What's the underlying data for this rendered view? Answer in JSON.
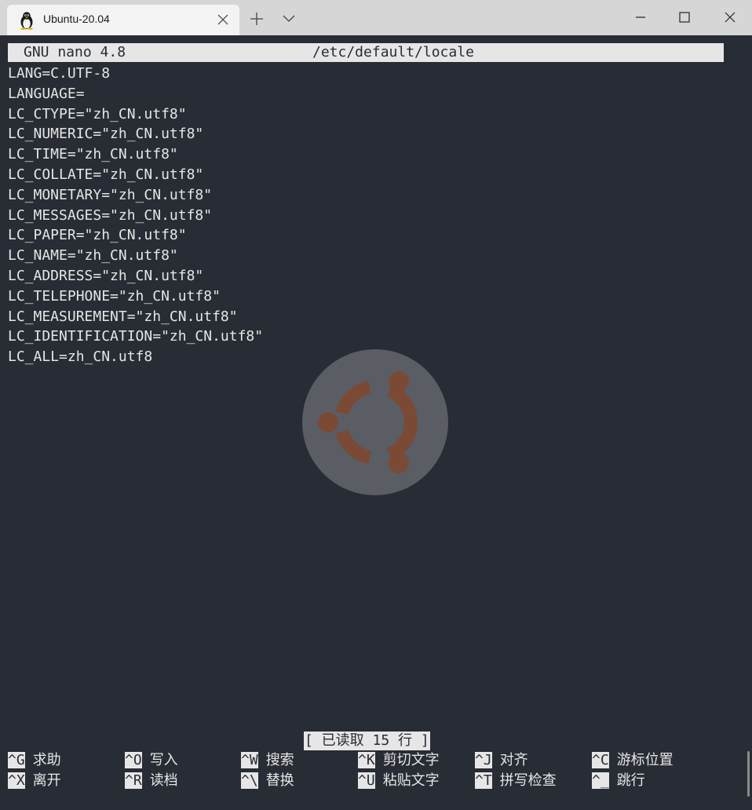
{
  "window": {
    "tab_title": "Ubuntu-20.04",
    "tab_icon": "tux-penguin-icon",
    "controls": [
      "minimize-icon",
      "maximize-icon",
      "close-icon"
    ]
  },
  "nano": {
    "version": "GNU nano 4.8",
    "filename": "/etc/default/locale",
    "lines": [
      "LANG=C.UTF-8",
      "LANGUAGE=",
      "LC_CTYPE=\"zh_CN.utf8\"",
      "LC_NUMERIC=\"zh_CN.utf8\"",
      "LC_TIME=\"zh_CN.utf8\"",
      "LC_COLLATE=\"zh_CN.utf8\"",
      "LC_MONETARY=\"zh_CN.utf8\"",
      "LC_MESSAGES=\"zh_CN.utf8\"",
      "LC_PAPER=\"zh_CN.utf8\"",
      "LC_NAME=\"zh_CN.utf8\"",
      "LC_ADDRESS=\"zh_CN.utf8\"",
      "LC_TELEPHONE=\"zh_CN.utf8\"",
      "LC_MEASUREMENT=\"zh_CN.utf8\"",
      "LC_IDENTIFICATION=\"zh_CN.utf8\"",
      "LC_ALL=zh_CN.utf8"
    ],
    "status": "[ 已读取 15 行 ]",
    "shortcuts_row1": [
      {
        "key": "^G",
        "label": "求助"
      },
      {
        "key": "^O",
        "label": "写入"
      },
      {
        "key": "^W",
        "label": "搜索"
      },
      {
        "key": "^K",
        "label": "剪切文字"
      },
      {
        "key": "^J",
        "label": "对齐"
      },
      {
        "key": "^C",
        "label": "游标位置"
      }
    ],
    "shortcuts_row2": [
      {
        "key": "^X",
        "label": "离开"
      },
      {
        "key": "^R",
        "label": "读档"
      },
      {
        "key": "^\\",
        "label": "替换"
      },
      {
        "key": "^U",
        "label": "粘贴文字"
      },
      {
        "key": "^T",
        "label": "拼写检查"
      },
      {
        "key": "^_",
        "label": "跳行"
      }
    ]
  },
  "colors": {
    "terminal_bg": "#282c34",
    "terminal_fg": "#e6e6e6",
    "titlebar_bg": "#d6d6d6",
    "watermark_circle": "#5a5d63",
    "watermark_logo": "#7a4a35"
  }
}
